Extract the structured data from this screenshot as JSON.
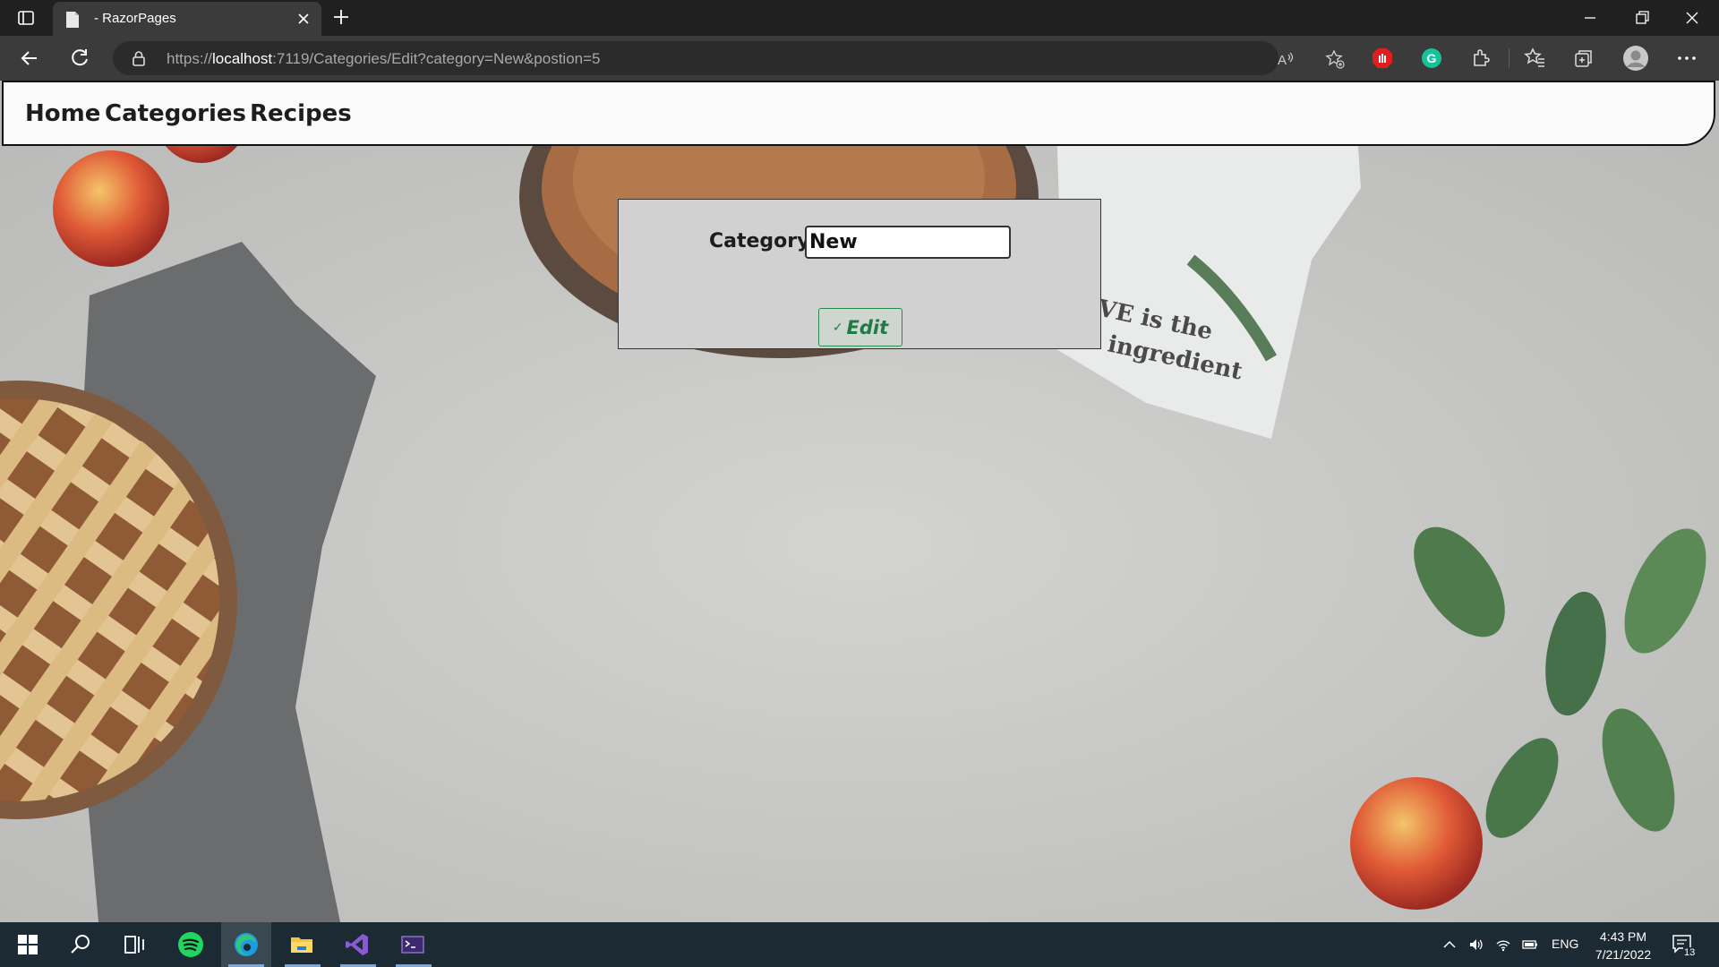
{
  "browser": {
    "tab_title": "- RazorPages",
    "url": {
      "scheme": "https://",
      "host": "localhost",
      "path": ":7119/Categories/Edit?category=New&postion=5"
    }
  },
  "nav": {
    "links": [
      "Home",
      "Categories",
      "Recipes"
    ]
  },
  "form": {
    "label": "Category",
    "input_value": "New",
    "button_label": "Edit",
    "button_icon": "check-icon"
  },
  "taskbar": {
    "language": "ENG",
    "time": "4:43 PM",
    "date": "7/21/2022",
    "notification_count": "13"
  },
  "colors": {
    "browser_dark": "#202020",
    "toolbar": "#3b3b3b",
    "edit_button": "#1f7a44",
    "taskbar": "#1c2a33"
  }
}
